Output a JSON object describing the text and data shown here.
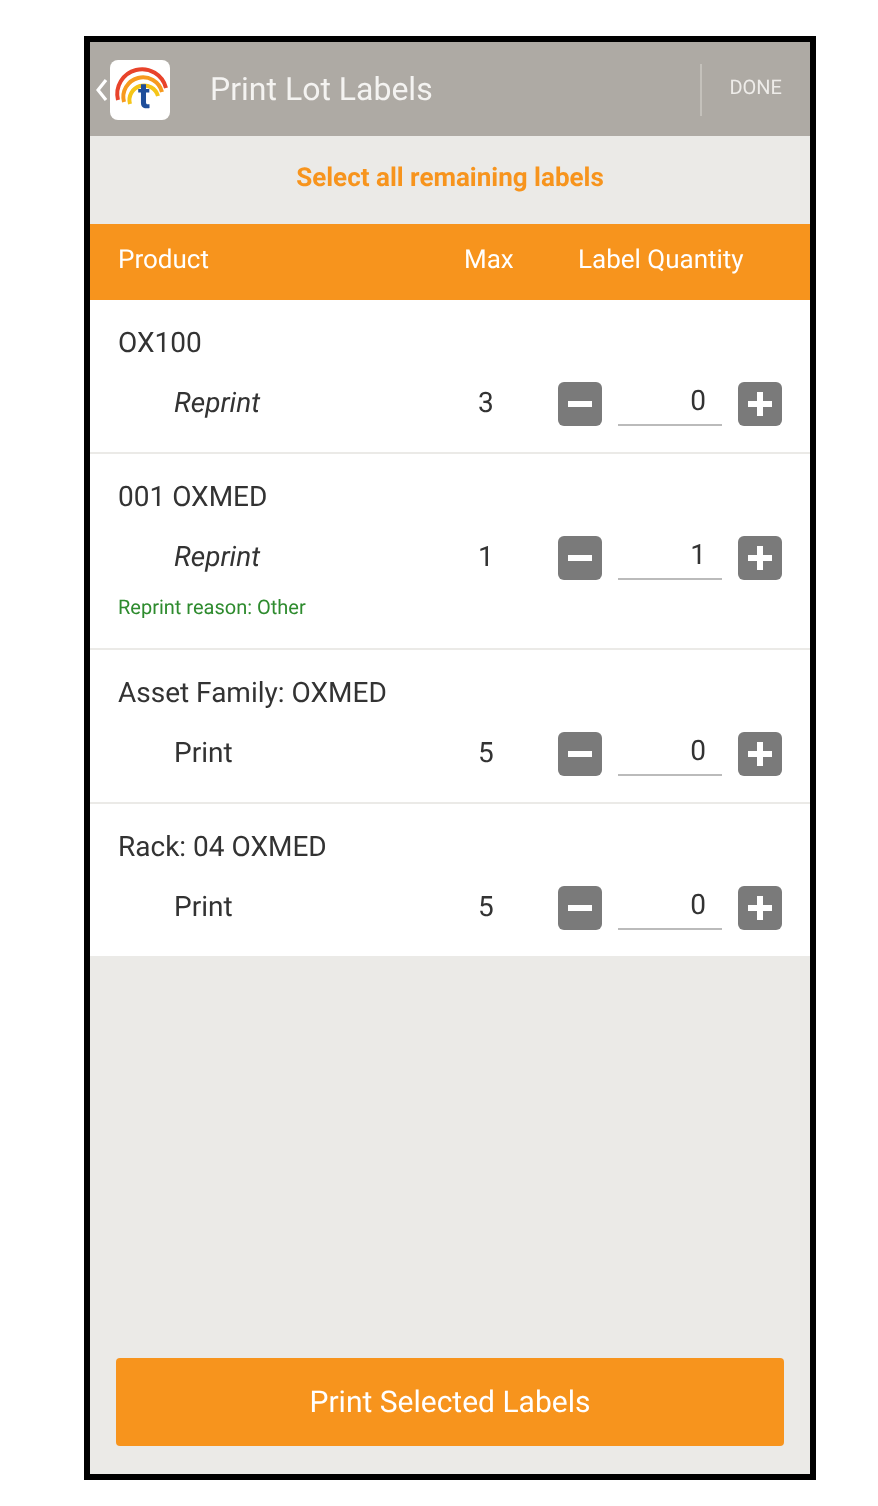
{
  "header": {
    "logo_letter": "t",
    "title": "Print Lot Labels",
    "done": "DONE"
  },
  "select_all": "Select all remaining labels",
  "columns": [
    "Product",
    "Max",
    "Label Quantity"
  ],
  "rows": [
    {
      "product": "OX100",
      "kind": "reprint",
      "action": "Reprint",
      "max": "3",
      "quantity": "0"
    },
    {
      "product": "001 OXMED",
      "kind": "reprint",
      "action": "Reprint",
      "max": "1",
      "quantity": "1",
      "reason": "Reprint reason: Other"
    },
    {
      "product": "Asset Family: OXMED",
      "kind": "print",
      "action": "Print",
      "max": "5",
      "quantity": "0"
    },
    {
      "product": "Rack: 04 OXMED",
      "kind": "print",
      "action": "Print",
      "max": "5",
      "quantity": "0"
    }
  ],
  "print_button": "Print Selected Labels"
}
